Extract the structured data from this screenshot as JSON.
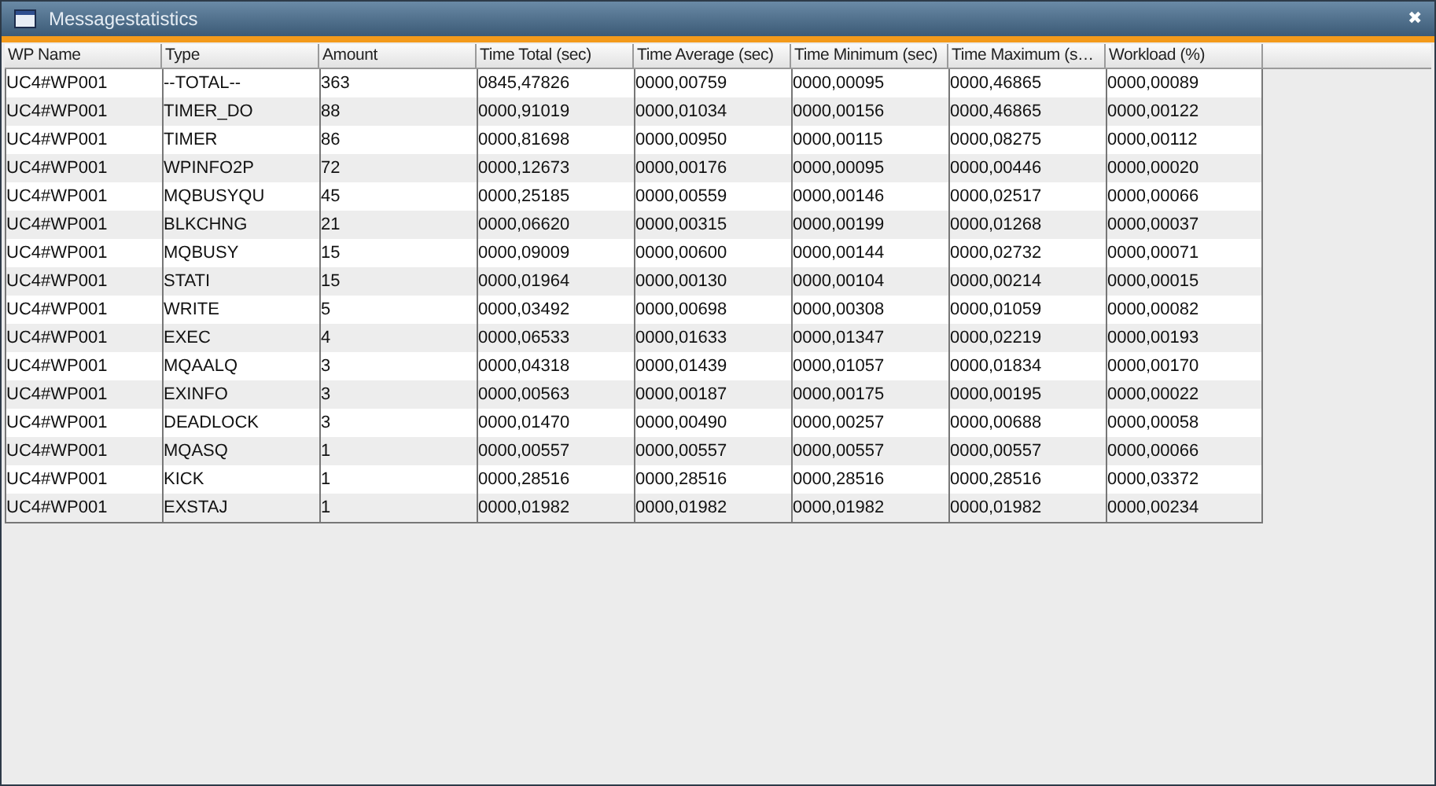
{
  "window": {
    "title": "Messagestatistics",
    "close": "✖"
  },
  "table": {
    "columns": [
      "WP Name",
      "Type",
      "Amount",
      "Time Total (sec)",
      "Time Average (sec)",
      "Time Minimum (sec)",
      "Time Maximum (s…",
      "Workload (%)"
    ],
    "rows": [
      [
        "UC4#WP001",
        "--TOTAL--",
        "363",
        "0845,47826",
        "0000,00759",
        "0000,00095",
        "0000,46865",
        "0000,00089"
      ],
      [
        "UC4#WP001",
        "TIMER_DO",
        "88",
        "0000,91019",
        "0000,01034",
        "0000,00156",
        "0000,46865",
        "0000,00122"
      ],
      [
        "UC4#WP001",
        "TIMER",
        "86",
        "0000,81698",
        "0000,00950",
        "0000,00115",
        "0000,08275",
        "0000,00112"
      ],
      [
        "UC4#WP001",
        "WPINFO2P",
        "72",
        "0000,12673",
        "0000,00176",
        "0000,00095",
        "0000,00446",
        "0000,00020"
      ],
      [
        "UC4#WP001",
        "MQBUSYQU",
        "45",
        "0000,25185",
        "0000,00559",
        "0000,00146",
        "0000,02517",
        "0000,00066"
      ],
      [
        "UC4#WP001",
        "BLKCHNG",
        "21",
        "0000,06620",
        "0000,00315",
        "0000,00199",
        "0000,01268",
        "0000,00037"
      ],
      [
        "UC4#WP001",
        "MQBUSY",
        "15",
        "0000,09009",
        "0000,00600",
        "0000,00144",
        "0000,02732",
        "0000,00071"
      ],
      [
        "UC4#WP001",
        "STATI",
        "15",
        "0000,01964",
        "0000,00130",
        "0000,00104",
        "0000,00214",
        "0000,00015"
      ],
      [
        "UC4#WP001",
        "WRITE",
        "5",
        "0000,03492",
        "0000,00698",
        "0000,00308",
        "0000,01059",
        "0000,00082"
      ],
      [
        "UC4#WP001",
        "EXEC",
        "4",
        "0000,06533",
        "0000,01633",
        "0000,01347",
        "0000,02219",
        "0000,00193"
      ],
      [
        "UC4#WP001",
        "MQAALQ",
        "3",
        "0000,04318",
        "0000,01439",
        "0000,01057",
        "0000,01834",
        "0000,00170"
      ],
      [
        "UC4#WP001",
        "EXINFO",
        "3",
        "0000,00563",
        "0000,00187",
        "0000,00175",
        "0000,00195",
        "0000,00022"
      ],
      [
        "UC4#WP001",
        "DEADLOCK",
        "3",
        "0000,01470",
        "0000,00490",
        "0000,00257",
        "0000,00688",
        "0000,00058"
      ],
      [
        "UC4#WP001",
        "MQASQ",
        "1",
        "0000,00557",
        "0000,00557",
        "0000,00557",
        "0000,00557",
        "0000,00066"
      ],
      [
        "UC4#WP001",
        "KICK",
        "1",
        "0000,28516",
        "0000,28516",
        "0000,28516",
        "0000,28516",
        "0000,03372"
      ],
      [
        "UC4#WP001",
        "EXSTAJ",
        "1",
        "0000,01982",
        "0000,01982",
        "0000,01982",
        "0000,01982",
        "0000,00234"
      ]
    ]
  }
}
